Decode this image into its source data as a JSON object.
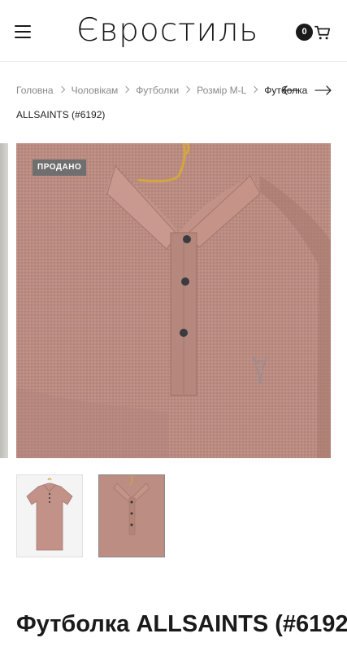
{
  "header": {
    "logo_text": "Євростиль",
    "cart_count": "0"
  },
  "breadcrumb": {
    "items": [
      "Головна",
      "Чоловікам",
      "Футболки",
      "Розмір M-L"
    ],
    "current_line1": "Футболка",
    "current_line2": "ALLSAINTS (#6192)"
  },
  "gallery": {
    "badge": "ПРОДАНО",
    "brand_stitch": "ALLSAINTS"
  },
  "product": {
    "title": "Футболка ALLSAINTS (#6192)"
  },
  "colors": {
    "shirt": "#b88a80",
    "badge_bg": "#6f6f6f",
    "text": "#1a1a1a"
  }
}
